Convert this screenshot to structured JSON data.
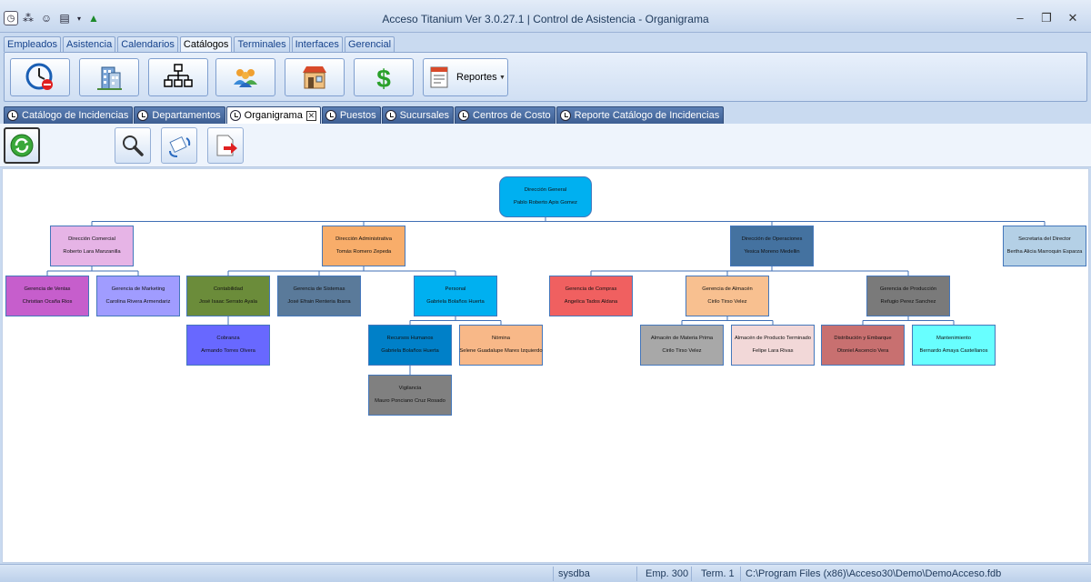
{
  "window": {
    "title": "Acceso Titanium  Ver 3.0.27.1 | Control de Asistencia - Organigrama",
    "minimize": "–",
    "restore": "❐",
    "close": "✕"
  },
  "ribbon_tabs": [
    "Empleados",
    "Asistencia",
    "Calendarios",
    "Catálogos",
    "Terminales",
    "Interfaces",
    "Gerencial"
  ],
  "ribbon_active": "Catálogos",
  "ribbon_buttons": {
    "reportes_label": "Reportes",
    "icons": [
      "incidencias-clock-icon",
      "building-icon",
      "org-chart-icon",
      "people-icon",
      "store-icon",
      "dollar-icon",
      "reports-icon"
    ]
  },
  "doc_tabs": [
    {
      "label": "Catálogo de Incidencias"
    },
    {
      "label": "Departamentos"
    },
    {
      "label": "Organigrama",
      "active": true
    },
    {
      "label": "Puestos"
    },
    {
      "label": "Sucursales"
    },
    {
      "label": "Centros de Costo"
    },
    {
      "label": "Reporte Catálogo de Incidencias"
    }
  ],
  "toolbar": {
    "icons": [
      "refresh-icon",
      "search-icon",
      "rotate-icon",
      "export-icon"
    ]
  },
  "org_chart": {
    "nodes": [
      {
        "id": "dg",
        "title": "Dirección General",
        "person": "Pablo Roberto Apis Gomez",
        "color": "#00b0f0"
      },
      {
        "id": "dc",
        "title": "Dirección Comercial",
        "person": "Roberto Lara Manzanilla",
        "color": "#e6b4e6"
      },
      {
        "id": "da",
        "title": "Dirección Administrativa",
        "person": "Tomás Romero Zepeda",
        "color": "#f8ad6a"
      },
      {
        "id": "do",
        "title": "Dirección de Operaciones",
        "person": "Yesica Moreno Medellin",
        "color": "#4472a0"
      },
      {
        "id": "sd",
        "title": "Secretaria del Director",
        "person": "Bertha Alicia Marroquin Esparza",
        "color": "#b4d0e6"
      },
      {
        "id": "gv",
        "title": "Gerencia de Ventas",
        "person": "Christian Ocaña Rios",
        "color": "#c65ecc"
      },
      {
        "id": "gm",
        "title": "Gerencia de Marketing",
        "person": "Carolina Rivera Armendariz",
        "color": "#a09cff"
      },
      {
        "id": "co",
        "title": "Contabilidad",
        "person": "José Isaac Serrato Ayala",
        "color": "#6b8c3a"
      },
      {
        "id": "gs",
        "title": "Gerencia de Sistemas",
        "person": "José Efrain Renteria Ibarra",
        "color": "#5a7a9a"
      },
      {
        "id": "pe",
        "title": "Personal",
        "person": "Gabriela Bolaños Huerta",
        "color": "#00b0f0"
      },
      {
        "id": "gc",
        "title": "Gerencia de Compras",
        "person": "Angelica Tados Aldana",
        "color": "#f06060"
      },
      {
        "id": "gal",
        "title": "Gerencia de Almacén",
        "person": "Cirilo Tirso Velez",
        "color": "#f8c090"
      },
      {
        "id": "gp",
        "title": "Gerencia de Producción",
        "person": "Refugio Perez Sanchez",
        "color": "#7a7a7a"
      },
      {
        "id": "cb",
        "title": "Cobranza",
        "person": "Armando Torres Olvera",
        "color": "#6868ff"
      },
      {
        "id": "rh",
        "title": "Recursos Humanos",
        "person": "Gabriela Bolaños Huerta",
        "color": "#0080c8"
      },
      {
        "id": "no",
        "title": "Nómina",
        "person": "Selene Guadalupe Mares Izquierdo",
        "color": "#f8b888"
      },
      {
        "id": "amp",
        "title": "Almacén de Materia Prima",
        "person": "Cirilo Tirso Velez",
        "color": "#a8a8a8"
      },
      {
        "id": "apt",
        "title": "Almacén de Producto Terminado",
        "person": "Felipe Lara Rivas",
        "color": "#f2d8d8"
      },
      {
        "id": "de",
        "title": "Distribución y Embarque",
        "person": "Otoniel Ascencio Vera",
        "color": "#c87070"
      },
      {
        "id": "mt",
        "title": "Mantenimiento",
        "person": "Bernardo Amaya Castellanos",
        "color": "#68ffff"
      },
      {
        "id": "vi",
        "title": "Vigilancia",
        "person": "Mauro Ponciano Cruz Rosado",
        "color": "#808080"
      }
    ],
    "edges": [
      [
        "dg",
        "dc"
      ],
      [
        "dg",
        "da"
      ],
      [
        "dg",
        "do"
      ],
      [
        "dg",
        "sd"
      ],
      [
        "dc",
        "gv"
      ],
      [
        "dc",
        "gm"
      ],
      [
        "da",
        "co"
      ],
      [
        "da",
        "gs"
      ],
      [
        "da",
        "pe"
      ],
      [
        "co",
        "cb"
      ],
      [
        "pe",
        "rh"
      ],
      [
        "pe",
        "no"
      ],
      [
        "rh",
        "vi"
      ],
      [
        "do",
        "gc"
      ],
      [
        "do",
        "gal"
      ],
      [
        "do",
        "gp"
      ],
      [
        "gal",
        "amp"
      ],
      [
        "gal",
        "apt"
      ],
      [
        "gp",
        "de"
      ],
      [
        "gp",
        "mt"
      ]
    ]
  },
  "status": {
    "user": "sysdba",
    "employees": "Emp. 300",
    "terminal": "Term. 1",
    "path": "C:\\Program Files (x86)\\Acceso30\\Demo\\DemoAcceso.fdb"
  }
}
